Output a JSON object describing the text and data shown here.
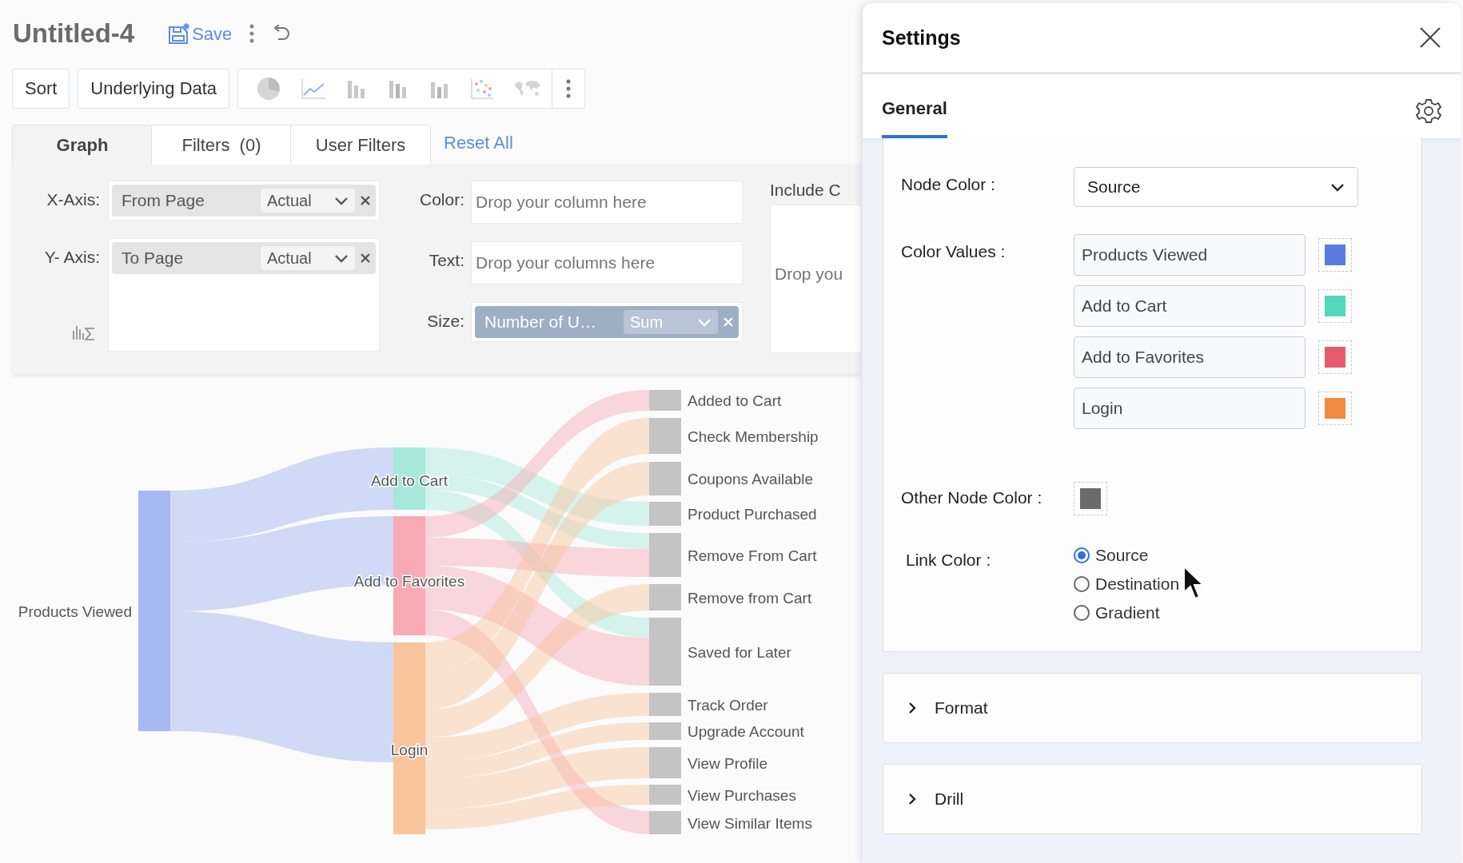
{
  "header": {
    "title": "Untitled-4",
    "save_label": "Save"
  },
  "toolbar": {
    "buttons": [
      "Sort",
      "Underlying Data"
    ],
    "chart_types": [
      {
        "kind": "pie"
      },
      {
        "kind": "line"
      },
      {
        "kind": "bar"
      },
      {
        "kind": "stacked"
      },
      {
        "kind": "waterfall"
      },
      {
        "kind": "scatter"
      },
      {
        "kind": "map"
      }
    ]
  },
  "tabs": [
    {
      "label": "Graph",
      "selected": true
    },
    {
      "label": "Filters  (0)",
      "selected": false
    },
    {
      "label": "User Filters",
      "selected": false
    }
  ],
  "reset_link": "Reset All",
  "shelves": {
    "x_axis": {
      "label": "X-Axis:",
      "field": "From Page",
      "aggregate": "Actual"
    },
    "y_axis": {
      "label": "Y- Axis:",
      "field": "To Page",
      "aggregate": "Actual"
    },
    "color": {
      "label": "Color:",
      "placeholder": "Drop your column here"
    },
    "text": {
      "label": "Text:",
      "placeholder": "Drop your columns here"
    },
    "size": {
      "label": "Size:",
      "field": "Number of U…",
      "aggregate": "Sum"
    },
    "include": {
      "label": "Include C",
      "placeholder": "Drop you"
    }
  },
  "sankey": {
    "sources": [
      {
        "label": "Products Viewed",
        "color": "#a6b8f2"
      }
    ],
    "steps": [
      {
        "label": "Add to Cart",
        "color": "#a6e9da"
      },
      {
        "label": "Add to Favorites",
        "color": "#f7a9b4"
      },
      {
        "label": "Login",
        "color": "#f9c39c"
      }
    ],
    "targets": [
      "Added to Cart",
      "Check Membership",
      "Coupons Available",
      "Product Purchased",
      "Remove From Cart",
      "Remove from Cart",
      "Saved for Later",
      "Track Order",
      "Upgrade Account",
      "View Profile",
      "View Purchases",
      "View Similar Items"
    ]
  },
  "settings": {
    "title": "Settings",
    "tabs": [
      {
        "label": "General",
        "selected": true
      }
    ],
    "node_color": {
      "label": "Node Color :",
      "value": "Source"
    },
    "color_values": {
      "label": "Color Values :",
      "items": [
        {
          "name": "Products Viewed",
          "color": "#5b7be0"
        },
        {
          "name": "Add to Cart",
          "color": "#55d6bd"
        },
        {
          "name": "Add to Favorites",
          "color": "#e65b6b"
        },
        {
          "name": "Login",
          "color": "#f08a3e"
        }
      ]
    },
    "other_node_color": {
      "label": "Other Node Color :",
      "color": "#6b6b6b"
    },
    "link_color": {
      "label": "Link Color :",
      "options": [
        {
          "label": "Source",
          "selected": true
        },
        {
          "label": "Destination",
          "selected": false
        },
        {
          "label": "Gradient",
          "selected": false
        }
      ]
    },
    "sections": [
      {
        "label": "Format",
        "expanded": false
      },
      {
        "label": "Drill",
        "expanded": false
      }
    ]
  }
}
